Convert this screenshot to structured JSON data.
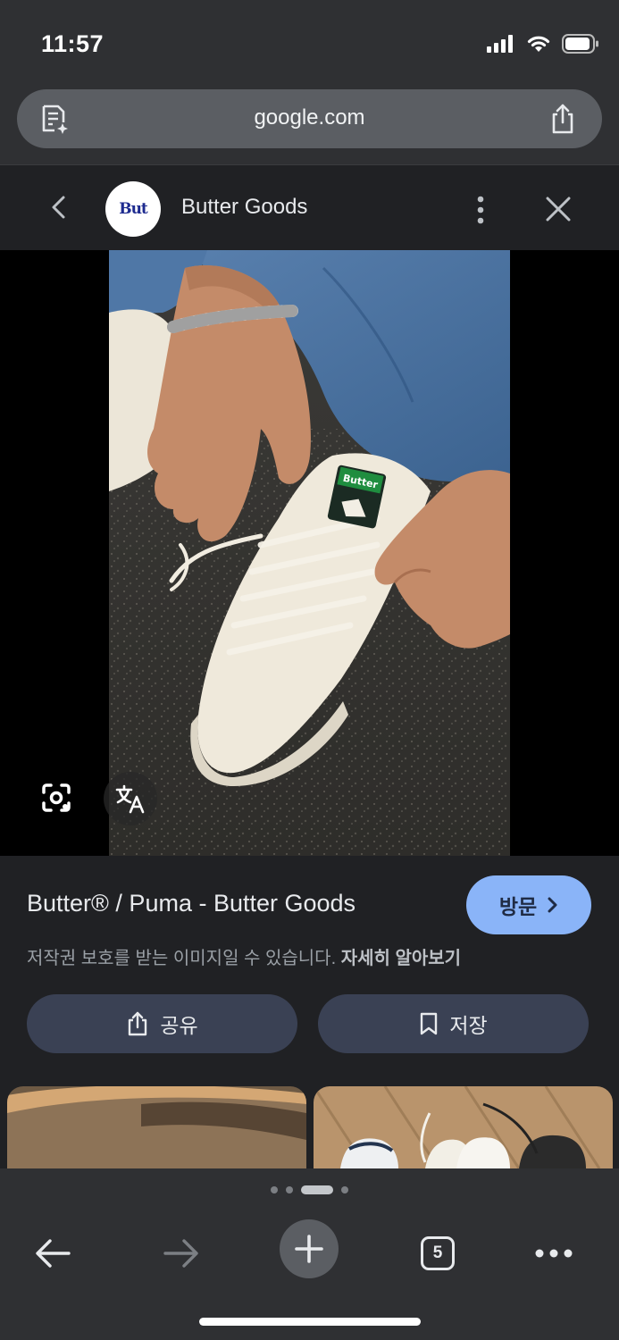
{
  "status_bar": {
    "time": "11:57"
  },
  "browser": {
    "url": "google.com",
    "open_tabs": "5"
  },
  "lens": {
    "site_name": "Butter Goods",
    "site_logo_text": "But"
  },
  "result": {
    "title": "Butter® / Puma - Butter Goods",
    "visit_label": "방문",
    "copyright_notice": "저작권 보호를 받는 이미지일 수 있습니다.",
    "learn_more": "자세히 알아보기",
    "share_label": "공유",
    "save_label": "저장"
  },
  "photo": {
    "tongue_label": "Butter"
  },
  "icons": {
    "page_summary": "page-summary-icon",
    "share": "share-icon",
    "back": "chevron-left-icon",
    "more": "more-vertical-icon",
    "close": "close-icon",
    "lens": "lens-icon",
    "translate": "translate-icon",
    "save": "bookmark-icon",
    "nav_back": "arrow-left-icon",
    "nav_forward": "arrow-right-icon",
    "new_tab": "plus-icon",
    "tabs": "tabs-icon",
    "menu": "more-horizontal-icon"
  },
  "colors": {
    "accent": "#8ab4f8",
    "background": "#202124",
    "chrome": "#2f3033",
    "action_button": "#3a4154"
  }
}
